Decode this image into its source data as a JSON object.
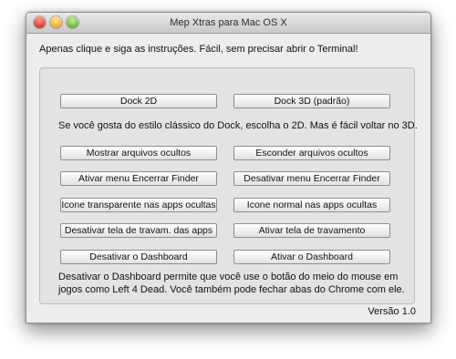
{
  "window": {
    "title": "Mep Xtras para Mac OS X"
  },
  "intro_text": "Apenas clique e siga as instruções. Fácil, sem precisar abrir o Terminal!",
  "buttons": {
    "dock_2d": "Dock 2D",
    "dock_3d": "Dock 3D (padrão)",
    "show_hidden": "Mostrar arquivos ocultos",
    "hide_hidden": "Esconder arquivos ocultos",
    "enable_quit_finder": "Ativar menu Encerrar Finder",
    "disable_quit_finder": "Desativar menu Encerrar Finder",
    "transparent_icon": "Icone transparente nas apps ocultas",
    "normal_icon": "Icone normal nas apps ocultas",
    "disable_lock_screen": "Desativar tela de travam. das apps",
    "enable_lock_screen": "Ativar tela de travamento",
    "disable_dashboard": "Desativar o Dashboard",
    "enable_dashboard": "Ativar o Dashboard"
  },
  "dock_note": "Se você gosta do estilo clássico do Dock, escolha o 2D. Mas é fácil voltar no 3D.",
  "dashboard_note_line1": "Desativar o Dashboard permite que você use o botão do meio do mouse em",
  "dashboard_note_line2": "jogos como Left 4 Dead. Você também pode fechar abas do Chrome com ele.",
  "version": "Versão 1.0"
}
